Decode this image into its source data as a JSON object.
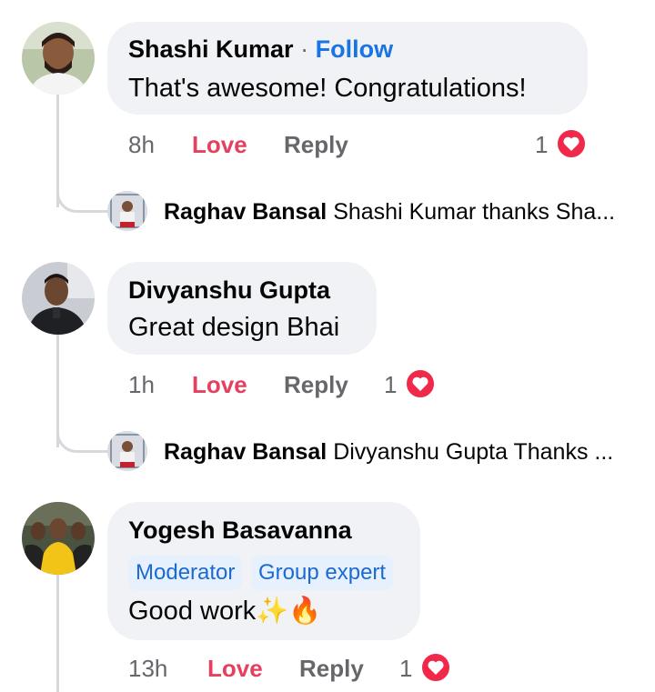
{
  "comments": [
    {
      "author": "Shashi Kumar",
      "separator": "·",
      "follow_label": "Follow",
      "text": "That's awesome! Congratulations!",
      "time": "8h",
      "love_label": "Love",
      "reply_label": "Reply",
      "reaction_count": "1",
      "reply_preview": {
        "author": "Raghav Bansal",
        "text": "Shashi Kumar thanks Sha..."
      }
    },
    {
      "author": "Divyanshu Gupta",
      "text": "Great design Bhai",
      "time": "1h",
      "love_label": "Love",
      "reply_label": "Reply",
      "reaction_count": "1",
      "reply_preview": {
        "author": "Raghav Bansal",
        "text": "Divyanshu Gupta Thanks ..."
      }
    },
    {
      "author": "Yogesh Basavanna",
      "badges": [
        "Moderator",
        "Group expert"
      ],
      "text": "Good work✨🔥",
      "time": "13h",
      "love_label": "Love",
      "reply_label": "Reply",
      "reaction_count": "1"
    }
  ],
  "icons": {
    "reaction": "heart-icon",
    "avatar": "user-avatar"
  },
  "colors": {
    "love": "#e4405f",
    "follow": "#1b74e4",
    "heart": "#f0284a",
    "bubble": "#f0f2f5",
    "badge_bg": "#e7f0fd",
    "badge_text": "#1b6ad4"
  }
}
